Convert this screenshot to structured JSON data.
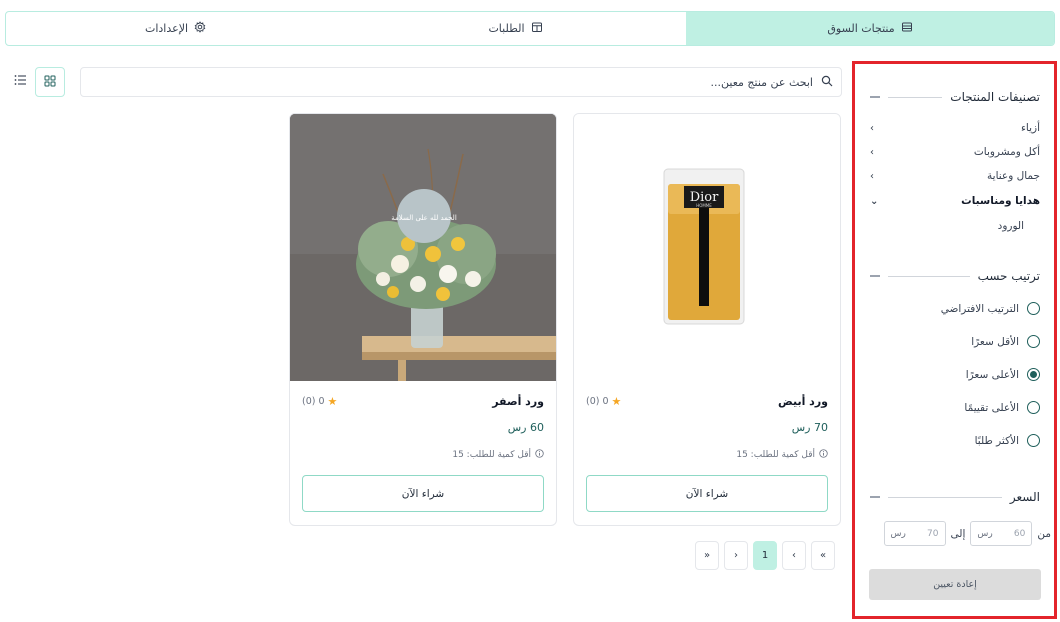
{
  "tabs": [
    {
      "label": "منتجات السوق",
      "icon": "storefront-icon",
      "active": true
    },
    {
      "label": "الطلبات",
      "icon": "calendar-icon",
      "active": false
    },
    {
      "label": "الإعدادات",
      "icon": "gear-icon",
      "active": false
    }
  ],
  "search": {
    "placeholder": "ابحث عن منتج معين..."
  },
  "sidebar": {
    "categories_title": "تصنيفات المنتجات",
    "categories": [
      {
        "label": "أزياء",
        "expanded": false
      },
      {
        "label": "أكل ومشروبات",
        "expanded": false
      },
      {
        "label": "جمال وعناية",
        "expanded": false
      },
      {
        "label": "هدايا ومناسبات",
        "expanded": true
      }
    ],
    "subcategory": "الورود",
    "sort_title": "ترتيب حسب",
    "sort_options": [
      {
        "label": "الترتيب الافتراضي",
        "checked": false
      },
      {
        "label": "الأقل سعرًا",
        "checked": false
      },
      {
        "label": "الأعلى سعرًا",
        "checked": true
      },
      {
        "label": "الأعلى تقييمًا",
        "checked": false
      },
      {
        "label": "الأكثر طلبًا",
        "checked": false
      }
    ],
    "price_title": "السعر",
    "price_from_label": "من",
    "price_to_label": "إلى",
    "price_from_value": "60",
    "price_to_value": "70",
    "currency": "رس",
    "reset_label": "إعادة تعيين"
  },
  "products": [
    {
      "name": "ورد أبيض",
      "rating": "0",
      "reviews": "(0)",
      "price": "70 رس",
      "min_qty": "أقل كمية للطلب: 15",
      "buy_label": "شراء الآن",
      "image_brand": "Dior",
      "image_sub": "HOMME"
    },
    {
      "name": "ورد أصفر",
      "rating": "0",
      "reviews": "(0)",
      "price": "60 رس",
      "min_qty": "أقل كمية للطلب: 15",
      "buy_label": "شراء الآن",
      "image_tag": "الحمد لله على السلامة"
    }
  ],
  "pagination": {
    "first": "«",
    "prev": "‹",
    "current": "1",
    "next": "›",
    "last": "»"
  },
  "colors": {
    "accent": "#bff0e3",
    "primary_dark": "#1f5f5b",
    "highlight_border": "#e3242b",
    "star": "#f5a623"
  }
}
